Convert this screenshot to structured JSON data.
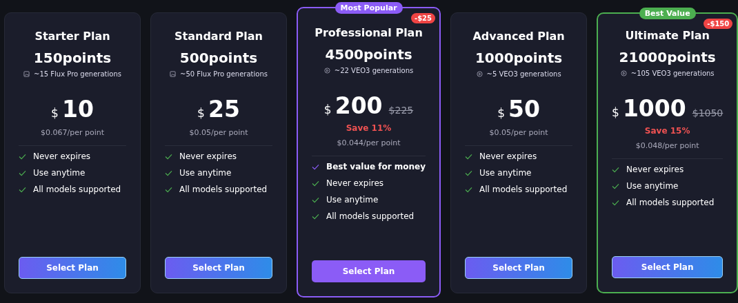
{
  "plans": [
    {
      "kind": "plain",
      "name": "Starter Plan",
      "points": "150points",
      "generations": {
        "kind": "image",
        "text": "~15 Flux Pro generations"
      },
      "currency": "$",
      "price": "10",
      "per_point": "$0.067/per point",
      "features": [
        {
          "text": "Never expires",
          "highlight": false
        },
        {
          "text": "Use anytime",
          "highlight": false
        },
        {
          "text": "All models supported",
          "highlight": false
        }
      ],
      "button": "Select Plan"
    },
    {
      "kind": "plain",
      "name": "Standard Plan",
      "points": "500points",
      "generations": {
        "kind": "image",
        "text": "~50 Flux Pro generations"
      },
      "currency": "$",
      "price": "25",
      "per_point": "$0.05/per point",
      "features": [
        {
          "text": "Never expires",
          "highlight": false
        },
        {
          "text": "Use anytime",
          "highlight": false
        },
        {
          "text": "All models supported",
          "highlight": false
        }
      ],
      "button": "Select Plan"
    },
    {
      "kind": "popular",
      "badge": "Most Popular",
      "discount": "-$25",
      "name": "Professional Plan",
      "points": "4500points",
      "generations": {
        "kind": "video",
        "text": "~22 VEO3 generations"
      },
      "currency": "$",
      "price": "200",
      "original_price": "$225",
      "save": "Save 11%",
      "per_point": "$0.044/per point",
      "features": [
        {
          "text": "Best value for money",
          "highlight": true
        },
        {
          "text": "Never expires",
          "highlight": false
        },
        {
          "text": "Use anytime",
          "highlight": false
        },
        {
          "text": "All models supported",
          "highlight": false
        }
      ],
      "button": "Select Plan"
    },
    {
      "kind": "plain",
      "name": "Advanced Plan",
      "points": "1000points",
      "generations": {
        "kind": "video",
        "text": "~5 VEO3 generations"
      },
      "currency": "$",
      "price": "50",
      "per_point": "$0.05/per point",
      "features": [
        {
          "text": "Never expires",
          "highlight": false
        },
        {
          "text": "Use anytime",
          "highlight": false
        },
        {
          "text": "All models supported",
          "highlight": false
        }
      ],
      "button": "Select Plan"
    },
    {
      "kind": "best",
      "badge": "Best Value",
      "discount": "-$150",
      "name": "Ultimate Plan",
      "points": "21000points",
      "generations": {
        "kind": "video",
        "text": "~105 VEO3 generations"
      },
      "currency": "$",
      "price": "1000",
      "original_price": "$1050",
      "save": "Save 15%",
      "per_point": "$0.048/per point",
      "features": [
        {
          "text": "Never expires",
          "highlight": false
        },
        {
          "text": "Use anytime",
          "highlight": false
        },
        {
          "text": "All models supported",
          "highlight": false
        }
      ],
      "button": "Select Plan"
    }
  ]
}
